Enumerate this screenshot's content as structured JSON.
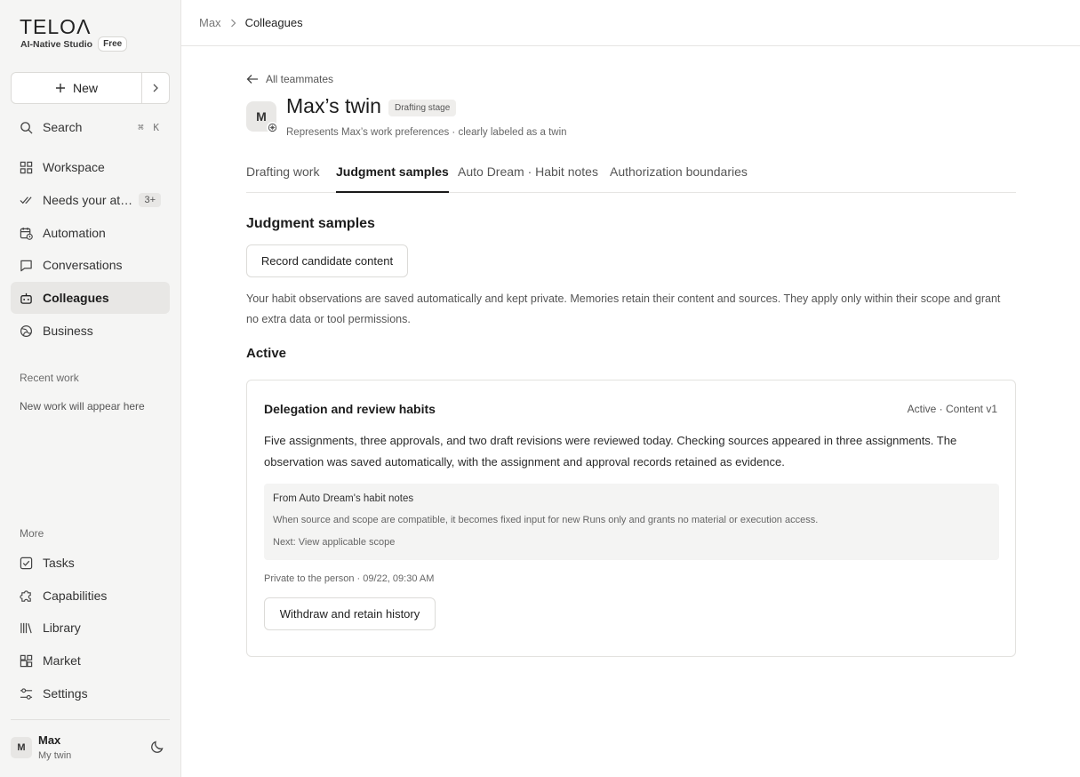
{
  "brand": {
    "logo": "TELOΛ",
    "studio": "AI-Native Studio",
    "plan": "Free"
  },
  "sidebar": {
    "new_label": "New",
    "search": {
      "label": "Search",
      "shortcut": "⌘ K"
    },
    "items": [
      {
        "label": "Workspace",
        "icon": "grid-icon"
      },
      {
        "label": "Needs your at…",
        "icon": "double-check-icon",
        "badge": "3+"
      },
      {
        "label": "Automation",
        "icon": "calendar-clock-icon"
      },
      {
        "label": "Conversations",
        "icon": "chat-icon"
      },
      {
        "label": "Colleagues",
        "icon": "bot-icon",
        "active": true
      },
      {
        "label": "Business",
        "icon": "globe-icon"
      }
    ],
    "recent_label": "Recent work",
    "recent_empty": "New work will appear here",
    "more_label": "More",
    "more_items": [
      {
        "label": "Tasks",
        "icon": "checkbox-icon"
      },
      {
        "label": "Capabilities",
        "icon": "puzzle-icon"
      },
      {
        "label": "Library",
        "icon": "books-icon"
      },
      {
        "label": "Market",
        "icon": "apps-icon"
      },
      {
        "label": "Settings",
        "icon": "sliders-icon"
      }
    ],
    "user": {
      "initial": "M",
      "name": "Max",
      "sub": "My twin"
    }
  },
  "breadcrumb": {
    "parent": "Max",
    "current": "Colleagues"
  },
  "header": {
    "back_label": "All teammates",
    "avatar_initial": "M",
    "title": "Max’s twin",
    "stage": "Drafting stage",
    "subtitle": "Represents Max’s work preferences · clearly labeled as a twin"
  },
  "tabs": [
    {
      "label": "Drafting work"
    },
    {
      "label": "Judgment samples",
      "active": true
    },
    {
      "label": "Auto Dream · Habit notes"
    },
    {
      "label": "Authorization boundaries"
    }
  ],
  "main": {
    "section_title": "Judgment samples",
    "record_button": "Record candidate content",
    "privacy_note": "Your habit observations are saved automatically and kept private. Memories retain their content and sources. They apply only within their scope and grant no extra data or tool permissions.",
    "active_title": "Active",
    "card": {
      "title": "Delegation and review habits",
      "status": "Active · Content v1",
      "body": "Five assignments, three approvals, and two draft revisions were reviewed today. Checking sources appeared in three assignments. The observation was saved automatically, with the assignment and approval records retained as evidence.",
      "note_title": "From Auto Dream's habit notes",
      "note_desc": "When source and scope are compatible, it becomes fixed input for new Runs only and grants no material or execution access.",
      "note_next": "Next: View applicable scope",
      "meta": "Private to the person · 09/22, 09:30 AM",
      "withdraw_button": "Withdraw and retain history"
    }
  }
}
